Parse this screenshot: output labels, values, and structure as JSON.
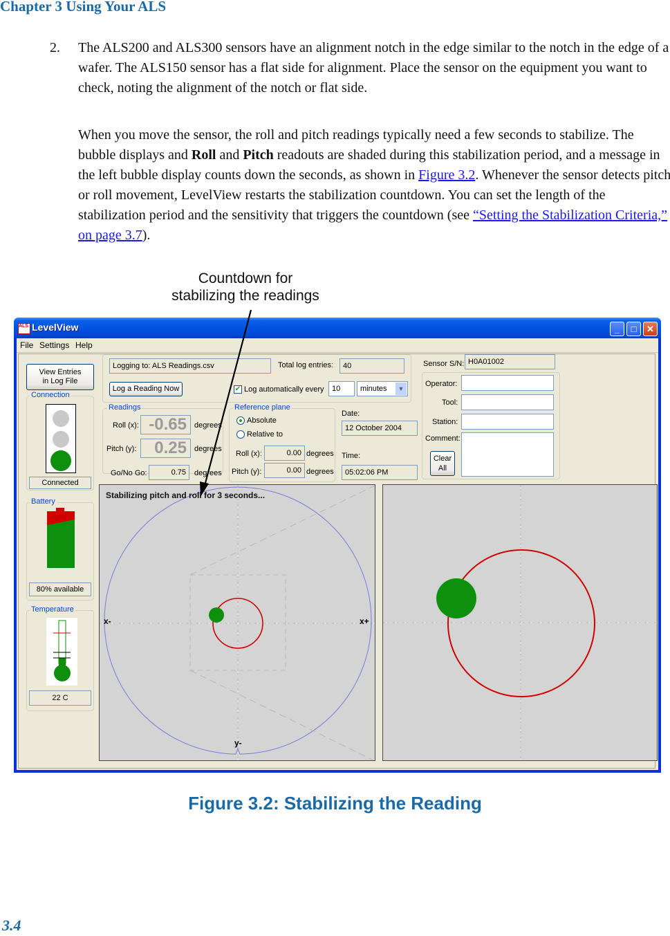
{
  "header": {
    "chapter": "Chapter 3  Using Your ALS"
  },
  "step": {
    "number": "2.",
    "text": "The ALS200 and ALS300 sensors have an alignment notch in the edge similar to the notch in the edge of a wafer. The ALS150 sensor has a flat side for alignment. Place the sensor on the equipment you want to check, noting the alignment of the notch or flat side."
  },
  "paragraph": {
    "part1": "When you move the sensor, the roll and pitch readings typically need a few seconds to stabilize. The bubble displays and ",
    "bold1": "Roll",
    "part2": " and ",
    "bold2": "Pitch",
    "part3": " readouts are shaded during this stabilization period, and a message in the left bubble display counts down the seconds, as shown in ",
    "link1": "Figure 3.2",
    "part4": ". Whenever the sensor detects pitch or roll movement, LevelView restarts the stabilization countdown. You can set the length of the stabilization period and the sensitivity that triggers the countdown (see ",
    "link2": "“Setting the Stabilization Criteria,” on page 3.7",
    "part5": ")."
  },
  "callout": {
    "line1": "Countdown for",
    "line2": "stabilizing the readings"
  },
  "window": {
    "title": "LevelView",
    "icon_text": "ALS",
    "controls": {
      "minimize": "_",
      "maximize": "□",
      "close": "✕"
    },
    "menu": [
      "File",
      "Settings",
      "Help"
    ],
    "view_log_button": {
      "line1": "View Entries",
      "line2": "in Log File"
    },
    "connection": {
      "label": "Connection",
      "status": "Connected",
      "lights": [
        "off",
        "off",
        "green"
      ]
    },
    "battery": {
      "label": "Battery",
      "status": "80% available",
      "percent": 80
    },
    "temperature": {
      "label": "Temperature",
      "status": "22 C"
    },
    "logging": {
      "file_label": "Logging to: ALS Readings.csv",
      "total_label": "Total log entries:",
      "total_value": "40",
      "log_now_button": "Log a Reading Now",
      "auto_label": "Log automatically every",
      "auto_checked": true,
      "interval_value": "10",
      "interval_unit": "minutes"
    },
    "readings": {
      "label": "Readings",
      "roll_label": "Roll (x):",
      "roll_value": "-0.65",
      "pitch_label": "Pitch (y):",
      "pitch_value": "0.25",
      "unit": "degrees",
      "gonogo_label": "Go/No Go:",
      "gonogo_value": "0.75"
    },
    "reference_plane": {
      "label": "Reference plane",
      "option_absolute": "Absolute",
      "option_relative": "Relative to",
      "selected": "Absolute",
      "roll_label": "Roll (x):",
      "roll_value": "0.00",
      "pitch_label": "Pitch (y):",
      "pitch_value": "0.00",
      "unit": "degrees"
    },
    "datetime": {
      "date_label": "Date:",
      "date_value": "12 October 2004",
      "time_label": "Time:",
      "time_value": "05:02:06 PM"
    },
    "sensor": {
      "sn_label": "Sensor S/N:",
      "sn_value": "H0A01002"
    },
    "info": {
      "operator_label": "Operator:",
      "operator_value": "",
      "tool_label": "Tool:",
      "tool_value": "",
      "station_label": "Station:",
      "station_value": "",
      "comment_label": "Comment:",
      "comment_value": "",
      "clear_button": {
        "line1": "Clear",
        "line2": "All"
      }
    },
    "bubble_display": {
      "message": "Stabilizing pitch and roll for  3 seconds...",
      "axis_x_minus": "x-",
      "axis_x_plus": "x+",
      "axis_y_minus": "y-"
    }
  },
  "caption": "Figure 3.2: Stabilizing the Reading",
  "page_number": "3.4"
}
